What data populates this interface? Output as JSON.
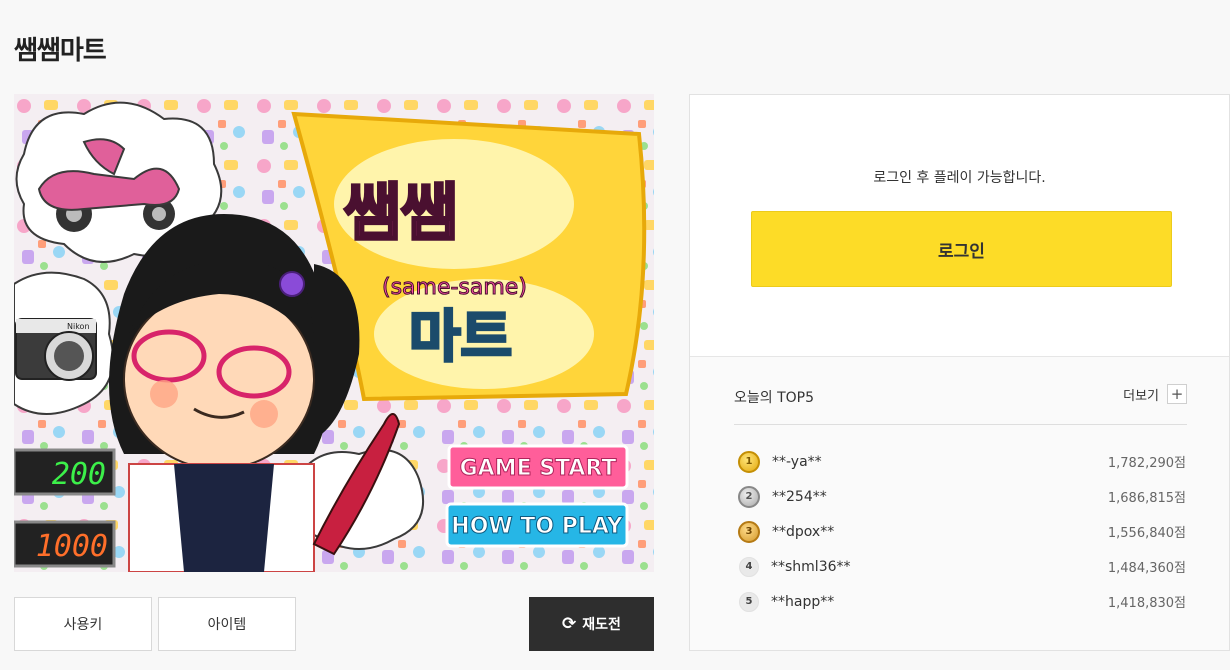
{
  "page": {
    "title": "쌤쌤마트"
  },
  "game": {
    "logo_main": "쌤쌤",
    "logo_sub": "(same-same)",
    "logo_bottom": "마트",
    "start_label": "GAME START",
    "howto_label": "HOW TO PLAY",
    "counter_top": "200",
    "counter_bottom": "1000",
    "camera_brand": "Nikon"
  },
  "controls": {
    "keys_label": "사용키",
    "items_label": "아이템",
    "retry_label": "재도전",
    "retry_icon": "refresh-icon"
  },
  "login": {
    "message": "로그인 후 플레이 가능합니다.",
    "button_label": "로그인",
    "button_color": "#fddc27"
  },
  "ranking": {
    "title": "오늘의 TOP5",
    "more_label": "더보기",
    "more_icon": "+",
    "entries": [
      {
        "rank": "1",
        "medal": "gold",
        "name": "**-ya**",
        "score": "1,782,290점"
      },
      {
        "rank": "2",
        "medal": "silver",
        "name": "**254**",
        "score": "1,686,815점"
      },
      {
        "rank": "3",
        "medal": "bronze",
        "name": "**dpox**",
        "score": "1,556,840점"
      },
      {
        "rank": "4",
        "medal": "plain",
        "name": "**shml36**",
        "score": "1,484,360점"
      },
      {
        "rank": "5",
        "medal": "plain",
        "name": "**happ**",
        "score": "1,418,830점"
      }
    ]
  }
}
